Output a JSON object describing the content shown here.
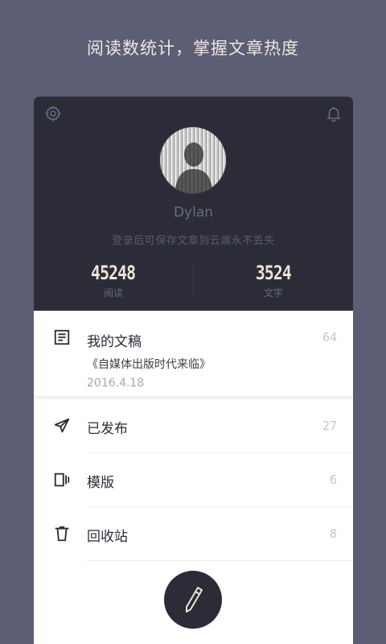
{
  "tagline": "阅读数统计，掌握文章热度",
  "profile": {
    "username": "Dylan",
    "hint": "登录后可保存文章到云端永不丢失",
    "stats": [
      {
        "value": "45248",
        "label": "阅读"
      },
      {
        "value": "3524",
        "label": "文字"
      }
    ]
  },
  "drafts": {
    "title": "我的文稿",
    "count": "64",
    "latest_title": "《自媒体出版时代来临》",
    "latest_date": "2016.4.18"
  },
  "menu": [
    {
      "label": "已发布",
      "count": "27",
      "icon": "send-icon"
    },
    {
      "label": "模版",
      "count": "6",
      "icon": "template-icon"
    },
    {
      "label": "回收站",
      "count": "8",
      "icon": "trash-icon"
    }
  ],
  "colors": {
    "background": "#5b5e74",
    "panel": "#2b2c38",
    "accent_text": "#efe3d3"
  }
}
